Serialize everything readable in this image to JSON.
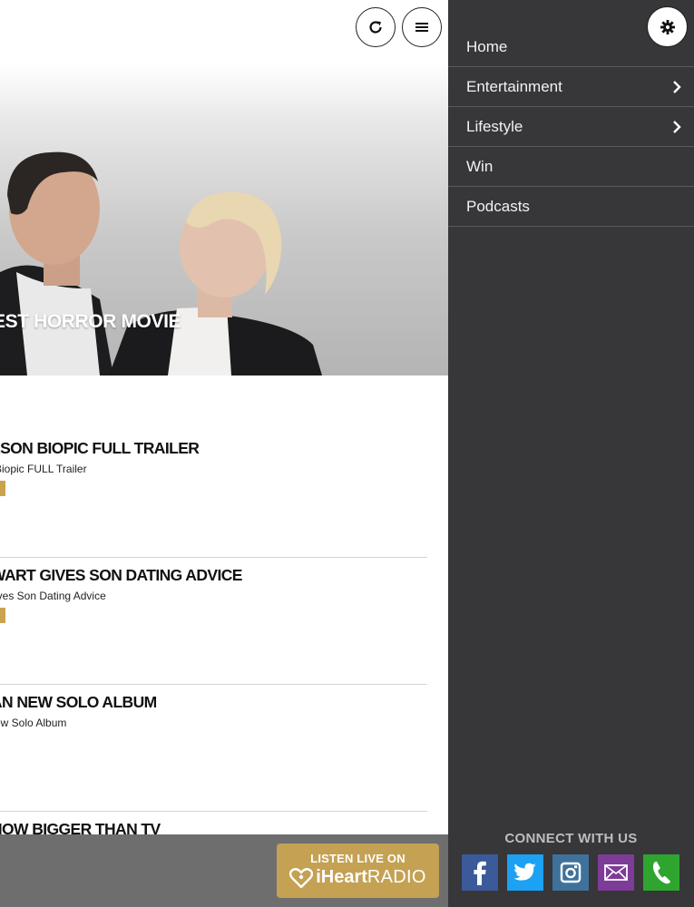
{
  "hero": {
    "title": "EST HORROR MOVIE"
  },
  "toolbar": {
    "refresh_icon": "refresh-icon",
    "menu_icon": "hamburger-menu-icon"
  },
  "articles": [
    {
      "title": "LSON BIOPIC FULL TRAILER",
      "subtitle": "Biopic FULL Trailer",
      "has_tag": true
    },
    {
      "title": "WART GIVES SON DATING ADVICE",
      "subtitle": "ives Son Dating Advice",
      "has_tag": true
    },
    {
      "title": "AN NEW SOLO ALBUM",
      "subtitle": "ew Solo Album",
      "has_tag": false
    },
    {
      "title": "NOW BIGGER THAN TV",
      "subtitle": "",
      "has_tag": false
    }
  ],
  "listen_button": {
    "line1": "LISTEN LIVE ON",
    "line2_bold": "iHeart",
    "line2_regular": "RADIO"
  },
  "drawer": {
    "settings_icon": "gear-icon",
    "nav": [
      {
        "label": "Home",
        "has_children": false
      },
      {
        "label": "Entertainment",
        "has_children": true
      },
      {
        "label": "Lifestyle",
        "has_children": true
      },
      {
        "label": "Win",
        "has_children": false
      },
      {
        "label": "Podcasts",
        "has_children": false
      }
    ],
    "connect_label": "CONNECT WITH US",
    "social": [
      {
        "icon": "facebook-icon",
        "color": "#3b5a9a"
      },
      {
        "icon": "twitter-icon",
        "color": "#1da1f2"
      },
      {
        "icon": "instagram-icon",
        "color": "#3f729b"
      },
      {
        "icon": "email-icon",
        "color": "#7d3c98"
      },
      {
        "icon": "phone-icon",
        "color": "#2fa52f"
      }
    ]
  },
  "colors": {
    "drawer_bg": "#373638",
    "accent_gold": "#c4a153",
    "tag_gold": "#c9a34f",
    "bottom_bar": "#6e6e6e"
  }
}
